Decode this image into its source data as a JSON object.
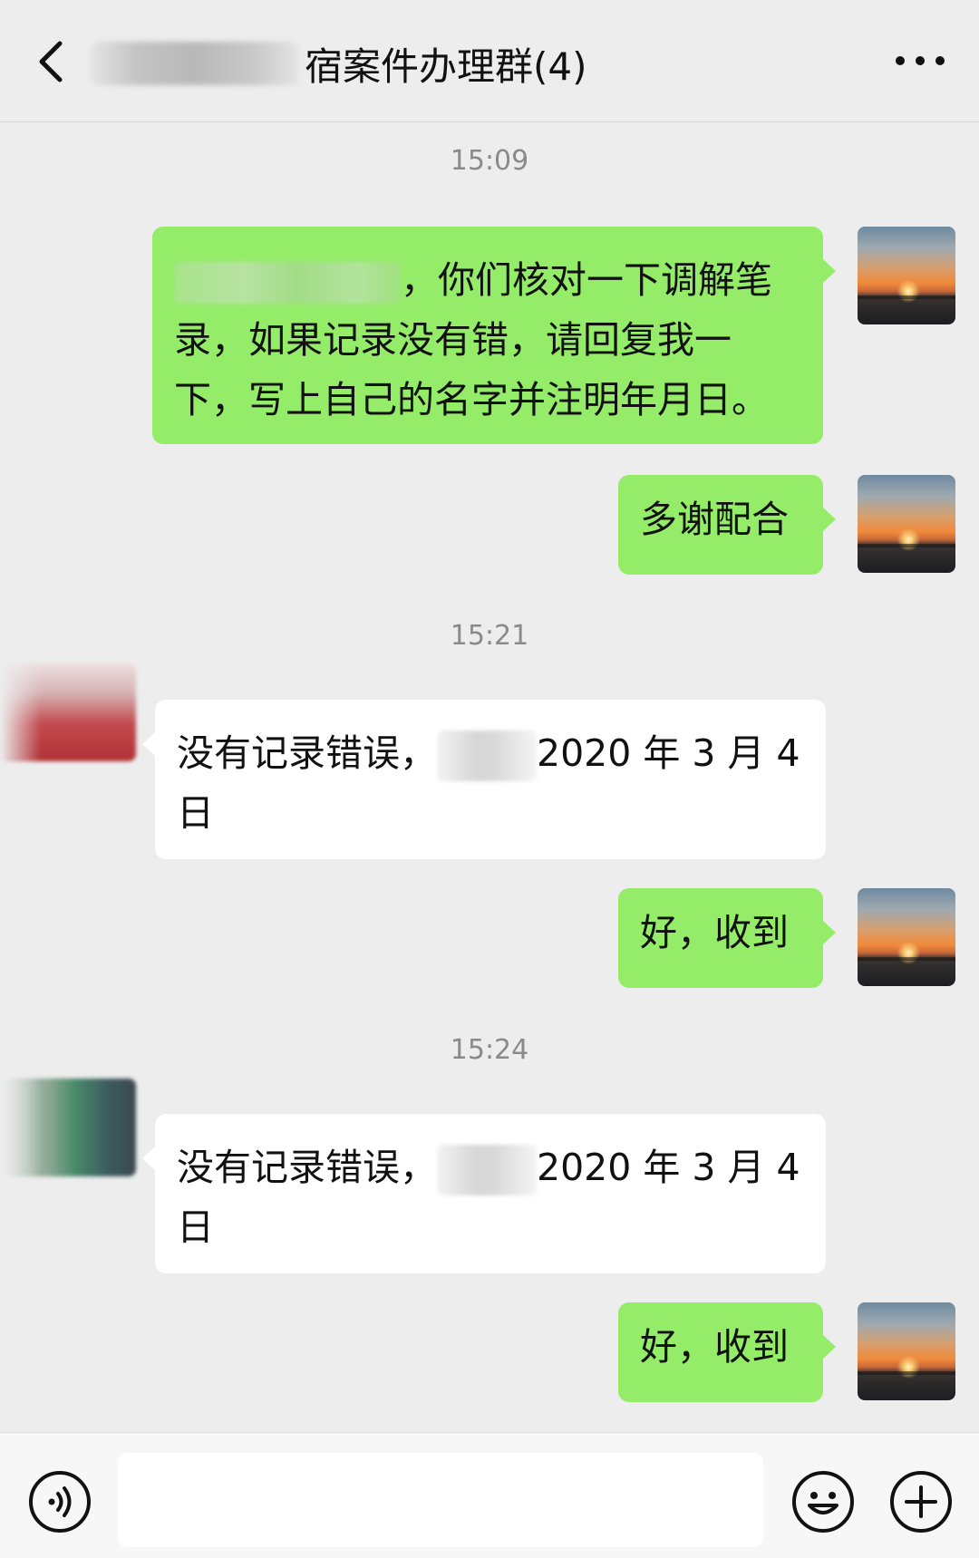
{
  "header": {
    "title": "宿案件办理群(4)",
    "back_icon": "chevron-left-icon",
    "more_icon": "more-dots-icon"
  },
  "messages": [
    {
      "type": "timestamp",
      "text": "15:09"
    },
    {
      "type": "outgoing",
      "text": "，你们核对一下调解笔录，如果记录没有错，请回复我一下，写上自己的名字并注明年月日。"
    },
    {
      "type": "outgoing",
      "text": "多谢配合"
    },
    {
      "type": "timestamp",
      "text": "15:21"
    },
    {
      "type": "incoming",
      "text_a": "没有记录错误，",
      "text_b": "2020 年 3 月 4 日"
    },
    {
      "type": "outgoing",
      "text": "好，收到"
    },
    {
      "type": "timestamp",
      "text": "15:24"
    },
    {
      "type": "incoming",
      "text_a": "没有记录错误，",
      "text_b": "2020 年 3 月 4 日"
    },
    {
      "type": "outgoing",
      "text": "好，收到"
    }
  ],
  "input_bar": {
    "voice_icon": "voice-icon",
    "emoji_icon": "emoji-icon",
    "plus_icon": "plus-icon",
    "input_value": ""
  },
  "colors": {
    "background": "#ededed",
    "outgoing_bubble": "#95ec69",
    "incoming_bubble": "#ffffff",
    "timestamp": "#8a8a8a"
  }
}
